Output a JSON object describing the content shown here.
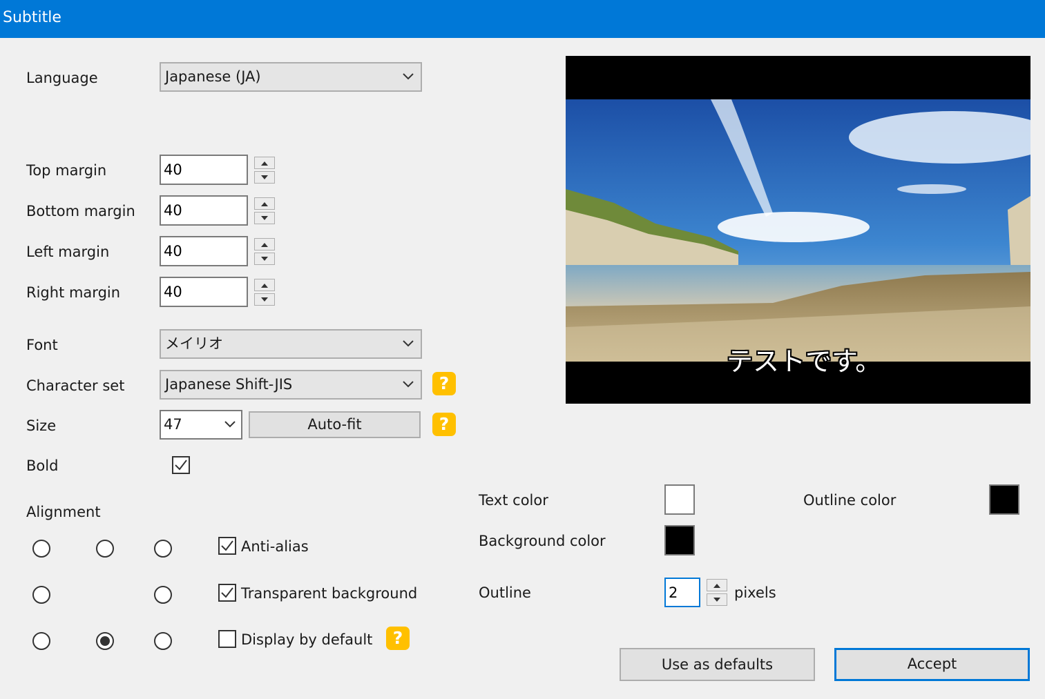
{
  "window": {
    "title": "Subtitle"
  },
  "form": {
    "language": {
      "label": "Language",
      "value": "Japanese (JA)"
    },
    "top_margin": {
      "label": "Top margin",
      "value": "40"
    },
    "bottom_margin": {
      "label": "Bottom margin",
      "value": "40"
    },
    "left_margin": {
      "label": "Left margin",
      "value": "40"
    },
    "right_margin": {
      "label": "Right margin",
      "value": "40"
    },
    "font": {
      "label": "Font",
      "value": "メイリオ"
    },
    "charset": {
      "label": "Character set",
      "value": "Japanese Shift-JIS"
    },
    "size": {
      "label": "Size",
      "value": "47",
      "autofit_label": "Auto-fit"
    },
    "bold": {
      "label": "Bold",
      "checked": true
    },
    "alignment": {
      "label": "Alignment",
      "selected": "bottom-center"
    },
    "anti_alias": {
      "label": "Anti-alias",
      "checked": true
    },
    "transparent_bg": {
      "label": "Transparent background",
      "checked": true
    },
    "display_default": {
      "label": "Display by default",
      "checked": false
    }
  },
  "colors": {
    "text_color": {
      "label": "Text color",
      "value": "#ffffff"
    },
    "outline_color": {
      "label": "Outline color",
      "value": "#000000"
    },
    "background_color": {
      "label": "Background color",
      "value": "#000000"
    },
    "outline": {
      "label": "Outline",
      "value": "2",
      "unit": "pixels"
    }
  },
  "preview": {
    "subtitle_text": "テストです。"
  },
  "buttons": {
    "use_defaults": "Use as defaults",
    "accept": "Accept"
  },
  "help_glyph": "?",
  "theme": {
    "title_bar": "#0078d7",
    "help_badge": "#ffc000",
    "focus_border": "#0078d7"
  }
}
